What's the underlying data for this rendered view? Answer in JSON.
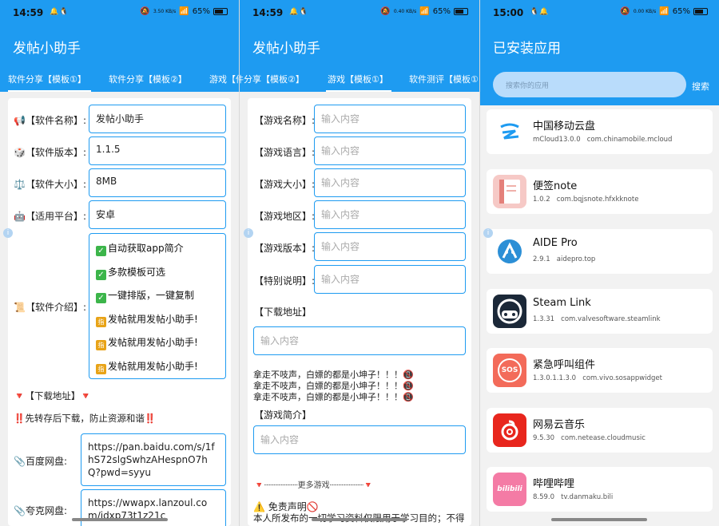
{
  "phones": [
    {
      "status": {
        "time": "14:59",
        "speed": "3.50\nKB/s",
        "battery": "65%"
      },
      "title": "发帖小助手",
      "tabs": [
        "软件分享【模板①】",
        "软件分享【模板②】",
        "游戏【件"
      ],
      "fields": [
        {
          "label": "📢【软件名称】:",
          "value": "发帖小助手"
        },
        {
          "label": "🎲【软件版本】:",
          "value": "1.1.5"
        },
        {
          "label": "⚖️【软件大小】:",
          "value": "8MB"
        },
        {
          "label": "🤖【适用平台】:",
          "value": "安卓"
        }
      ],
      "intro_label": "📜【软件介绍】:",
      "intro_lines": [
        {
          "badge": "✅",
          "text": "自动获取app简介"
        },
        {
          "badge": "✅",
          "text": "多款模板可选"
        },
        {
          "badge": "✅",
          "text": "一键排版，一键复制"
        },
        {
          "badge": "指",
          "text": "发帖就用发帖小助手!"
        },
        {
          "badge": "指",
          "text": "发帖就用发帖小助手!"
        },
        {
          "badge": "指",
          "text": "发帖就用发帖小助手!"
        }
      ],
      "download_header": "🔻【下载地址】🔻",
      "notice": "‼️先转存后下载，防止资源和谐‼️",
      "links": [
        {
          "label": "📎百度网盘:",
          "value": "https://pan.baidu.com/s/1fhS72slgSwhzAHespnO7hQ?pwd=syyu"
        },
        {
          "label": "📎夸克网盘:",
          "value": "https://wwapx.lanzoul.com/idxp73t1z21c"
        }
      ]
    },
    {
      "status": {
        "time": "14:59",
        "speed": "0.40\nKB/s",
        "battery": "65%"
      },
      "title": "发帖小助手",
      "tabs": [
        "件分享【模板②】",
        "游戏【模板①】",
        "软件测评【模板①"
      ],
      "fields": [
        {
          "label": "【游戏名称】:",
          "placeholder": "输入内容"
        },
        {
          "label": "【游戏语言】:",
          "placeholder": "输入内容"
        },
        {
          "label": "【游戏大小】:",
          "placeholder": "输入内容"
        },
        {
          "label": "【游戏地区】:",
          "placeholder": "输入内容"
        },
        {
          "label": "【游戏版本】:",
          "placeholder": "输入内容"
        },
        {
          "label": "【特别说明】:",
          "placeholder": "输入内容"
        }
      ],
      "download_label": "【下载地址】",
      "download_placeholder": "输入内容",
      "warn_lines": [
        "拿走不吱声，白嫖的都是小坤子！！！📵",
        "拿走不吱声，白嫖的都是小坤子！！！📵",
        "拿走不吱声，白嫖的都是小坤子！！！📵"
      ],
      "intro_label": "【游戏简介】",
      "intro_placeholder": "输入内容",
      "more": "🔻┈┈┈┈┈┈┈更多游戏┈┈┈┈┈┈┈🔻",
      "disclaimer_title": "⚠️ 免责声明🚫",
      "disclaimer_text": "本人所发布的一切学习资料仅限用于学习目的；不得将上述内容用于商业或者非法用途，否则，一切"
    },
    {
      "status": {
        "time": "15:00",
        "speed": "0.00\nKB/s",
        "battery": "65%"
      },
      "title": "已安装应用",
      "search_placeholder": "搜索你的应用",
      "search_button": "搜索",
      "apps": [
        {
          "name": "中国移动云盘",
          "version": "mCloud13.0.0",
          "package": "com.chinamobile.mcloud",
          "icon": "cloud-drive-icon"
        },
        {
          "name": "便签note",
          "version": "1.0.2",
          "package": "com.bqjsnote.hfxkknote",
          "icon": "notebook-icon"
        },
        {
          "name": "AIDE Pro",
          "version": "2.9.1",
          "package": "aidepro.top",
          "icon": "android-dev-icon"
        },
        {
          "name": "Steam Link",
          "version": "1.3.31",
          "package": "com.valvesoftware.steamlink",
          "icon": "gamepad-icon"
        },
        {
          "name": "紧急呼叫组件",
          "version": "1.3.0.1.1.3.0",
          "package": "com.vivo.sosappwidget",
          "icon": "sos-icon",
          "icon_text": "SOS"
        },
        {
          "name": "网易云音乐",
          "version": "9.5.30",
          "package": "com.netease.cloudmusic",
          "icon": "music-icon"
        },
        {
          "name": "哔哩哔哩",
          "version": "8.59.0",
          "package": "tv.danmaku.bili",
          "icon": "bilibili-icon",
          "icon_text": "bilibili"
        }
      ]
    }
  ],
  "colors": {
    "primary": "#1e9bf1",
    "search_bg": "#b9dcfb"
  }
}
